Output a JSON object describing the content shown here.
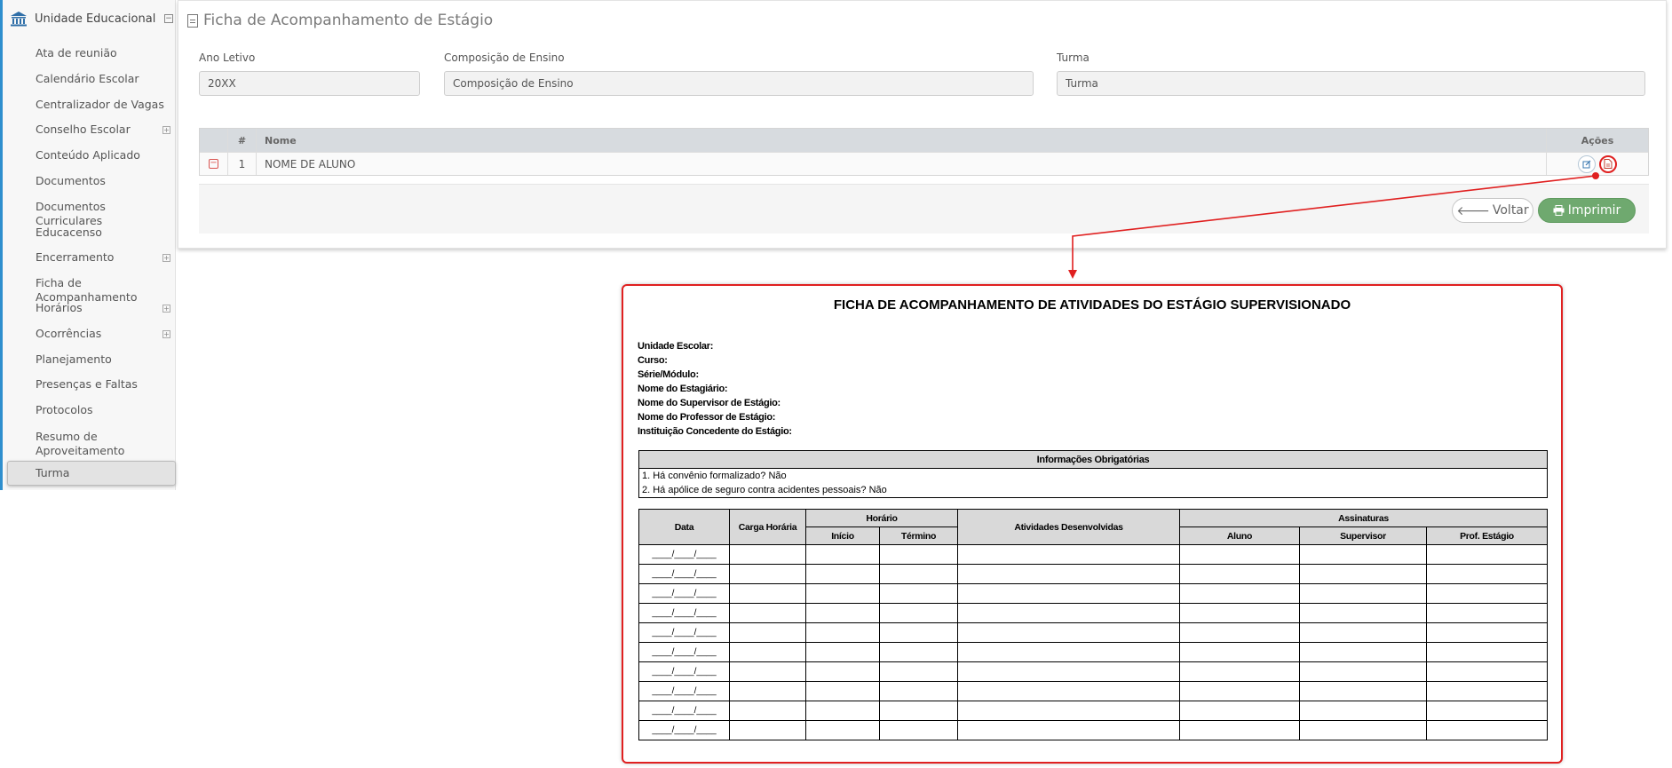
{
  "sidebar": {
    "header": "Unidade Educacional",
    "items": [
      {
        "label": "Ata de reunião",
        "expandable": false
      },
      {
        "label": "Calendário Escolar",
        "expandable": false
      },
      {
        "label": "Centralizador de Vagas",
        "expandable": false
      },
      {
        "label": "Conselho Escolar",
        "expandable": true
      },
      {
        "label": "Conteúdo Aplicado",
        "expandable": false
      },
      {
        "label": "Documentos",
        "expandable": false
      },
      {
        "label": "Documentos Curriculares",
        "expandable": false
      },
      {
        "label": "Educacenso",
        "expandable": false
      },
      {
        "label": "Encerramento",
        "expandable": true
      },
      {
        "label": "Ficha de Acompanhamento",
        "expandable": false
      },
      {
        "label": "Horários",
        "expandable": true
      },
      {
        "label": "Ocorrências",
        "expandable": true
      },
      {
        "label": "Planejamento",
        "expandable": false
      },
      {
        "label": "Presenças e Faltas",
        "expandable": false
      },
      {
        "label": "Protocolos",
        "expandable": false
      },
      {
        "label": "Resumo de",
        "label2": "Aproveitamento",
        "expandable": false
      },
      {
        "label": "Turma",
        "expandable": false,
        "active": true
      }
    ]
  },
  "page": {
    "title": "Ficha de Acompanhamento de Estágio",
    "fields": {
      "ano_letivo": {
        "label": "Ano Letivo",
        "value": "20XX"
      },
      "composicao": {
        "label": "Composição de Ensino",
        "value": "Composição de Ensino"
      },
      "turma": {
        "label": "Turma",
        "value": "Turma"
      }
    },
    "grid": {
      "headers": {
        "num": "#",
        "nome": "Nome",
        "acoes": "Ações"
      },
      "rows": [
        {
          "num": "1",
          "nome": "NOME DE ALUNO"
        }
      ]
    },
    "buttons": {
      "voltar": "Voltar",
      "imprimir": "Imprimir"
    }
  },
  "preview": {
    "title": "FICHA DE ACOMPANHAMENTO DE ATIVIDADES DO ESTÁGIO SUPERVISIONADO",
    "fields": [
      "Unidade Escolar:",
      "Curso:",
      "Série/Módulo:",
      "Nome do Estagiário:",
      "Nome do Supervisor de Estágio:",
      "Nome do Professor de Estágio:",
      "Instituição Concedente do Estágio:"
    ],
    "info": {
      "header": "Informações Obrigatórias",
      "lines": [
        "1. Há convênio formalizado? Não",
        "2. Há apólice de seguro contra acidentes pessoais? Não"
      ]
    },
    "table": {
      "data": "Data",
      "carga": "Carga Horária",
      "horario": "Horário",
      "inicio": "Início",
      "termino": "Término",
      "atividades": "Atividades Desenvolvidas",
      "assinaturas": "Assinaturas",
      "aluno": "Aluno",
      "supervisor": "Supervisor",
      "prof": "Prof. Estágio",
      "date_placeholder": "____/____/____",
      "row_count": 10
    }
  },
  "colors": {
    "accent": "#2f8fce",
    "highlight": "#e02020",
    "success": "#6fa96f"
  }
}
